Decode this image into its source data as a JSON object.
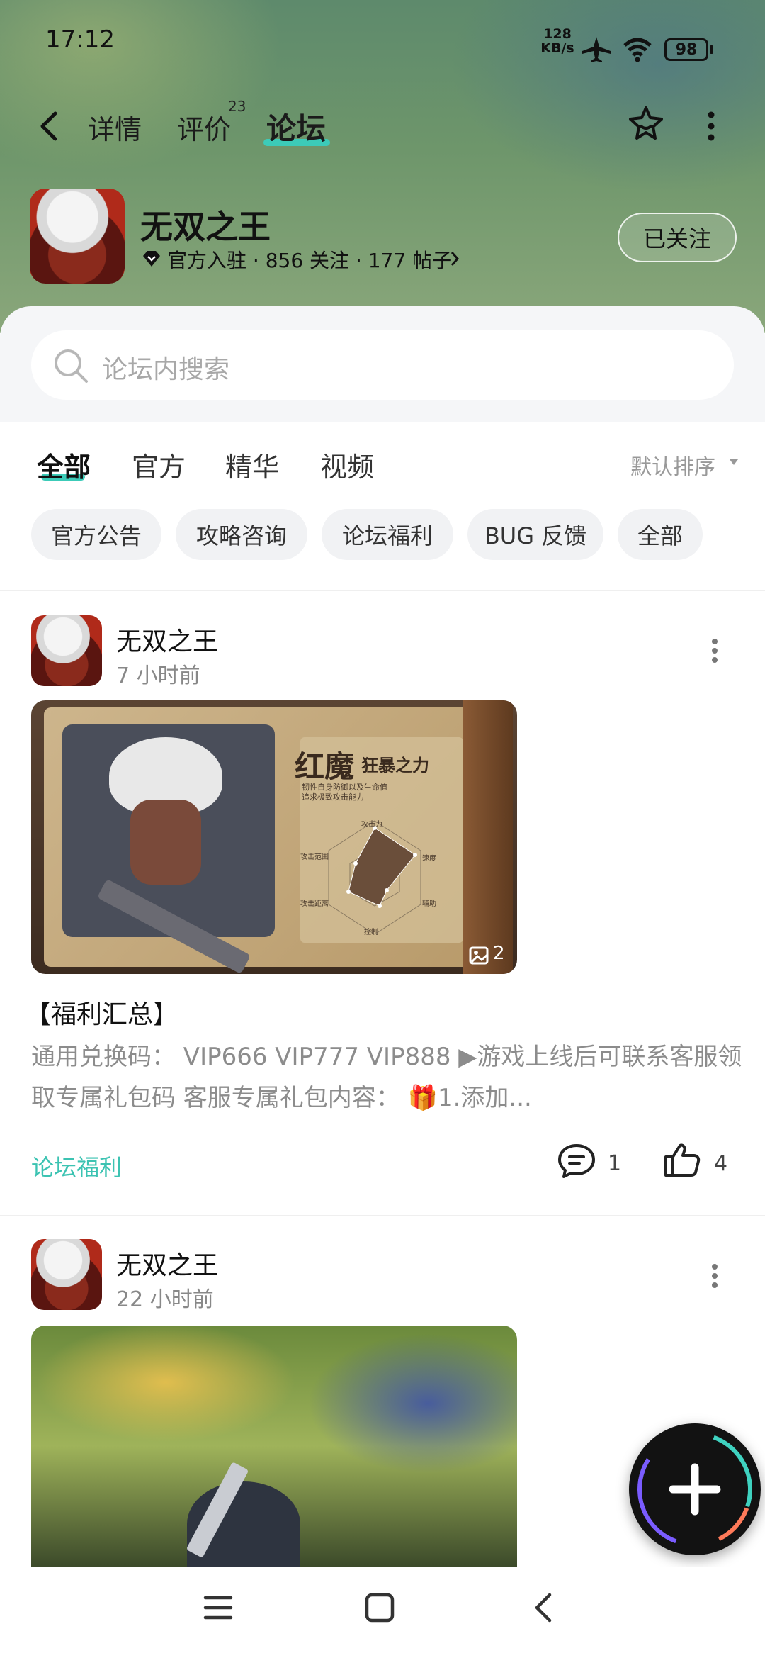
{
  "status_bar": {
    "time": "17:12",
    "net_speed_top": "128",
    "net_speed_bottom": "KB/s",
    "battery": "98"
  },
  "header": {
    "back_icon": "chevron-left-icon",
    "tabs": [
      {
        "label": "详情"
      },
      {
        "label": "评价",
        "badge": "23"
      },
      {
        "label": "论坛",
        "active": true
      }
    ],
    "favorite_icon": "star-badge-icon",
    "more_icon": "more-vertical-icon"
  },
  "game": {
    "name": "无双之王",
    "meta": "官方入驻 · 856 关注 · 177 帖子",
    "follow_label": "已关注"
  },
  "search": {
    "placeholder": "论坛内搜索"
  },
  "tabs": [
    {
      "label": "全部",
      "active": true
    },
    {
      "label": "官方"
    },
    {
      "label": "精华"
    },
    {
      "label": "视频"
    }
  ],
  "sort_label": "默认排序",
  "chips": [
    "官方公告",
    "攻略咨询",
    "论坛福利",
    "BUG 反馈",
    "全部"
  ],
  "posts": [
    {
      "author": "无双之王",
      "time": "7 小时前",
      "image_count": "2",
      "image_title": "红魔",
      "image_subtitle": "狂暴之力",
      "image_lines": [
        "韧性自身防御以及生命值",
        "追求极致攻击能力"
      ],
      "radar_labels": [
        "攻击力",
        "速度",
        "辅助",
        "控制",
        "攻击距离",
        "攻击范围"
      ],
      "title": "【福利汇总】",
      "excerpt": "通用兑换码： VIP666 VIP777 VIP888 ▶游戏上线后可联系客服领取专属礼包码 客服专属礼包内容： 🎁1.添加...",
      "tag": "论坛福利",
      "comments": "1",
      "likes": "4"
    },
    {
      "author": "无双之王",
      "time": "22 小时前"
    }
  ],
  "colors": {
    "accent": "#3ccbb8",
    "tag": "#3cc3b2"
  }
}
